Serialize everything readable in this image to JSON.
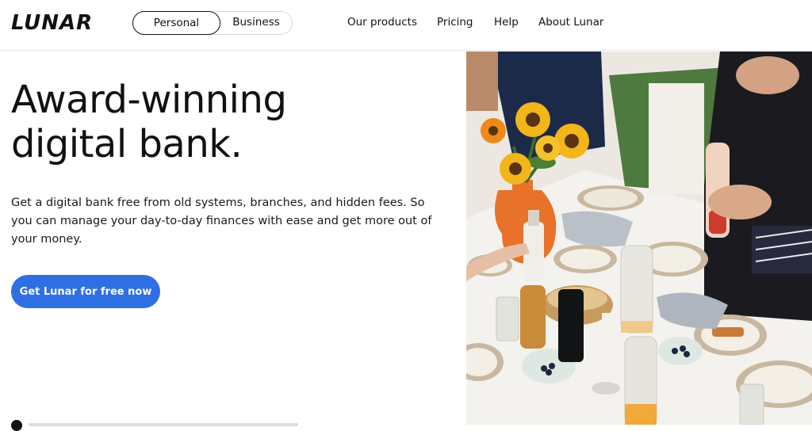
{
  "header": {
    "logo": "LUNAR",
    "segment": {
      "personal": "Personal",
      "business": "Business",
      "selected": "Personal"
    },
    "nav": [
      "Our products",
      "Pricing",
      "Help",
      "About Lunar"
    ]
  },
  "hero": {
    "title_line1": "Award-winning",
    "title_line2": "digital bank.",
    "description": "Get a digital bank free from old systems, branches, and hidden fees. So you can manage your day-to-day finances with ease and get more out of your money.",
    "cta_label": "Get Lunar for free now"
  },
  "colors": {
    "accent": "#2f6fe4",
    "text": "#111111"
  },
  "photo": {
    "subject": "dinner-table-with-sunflowers"
  }
}
